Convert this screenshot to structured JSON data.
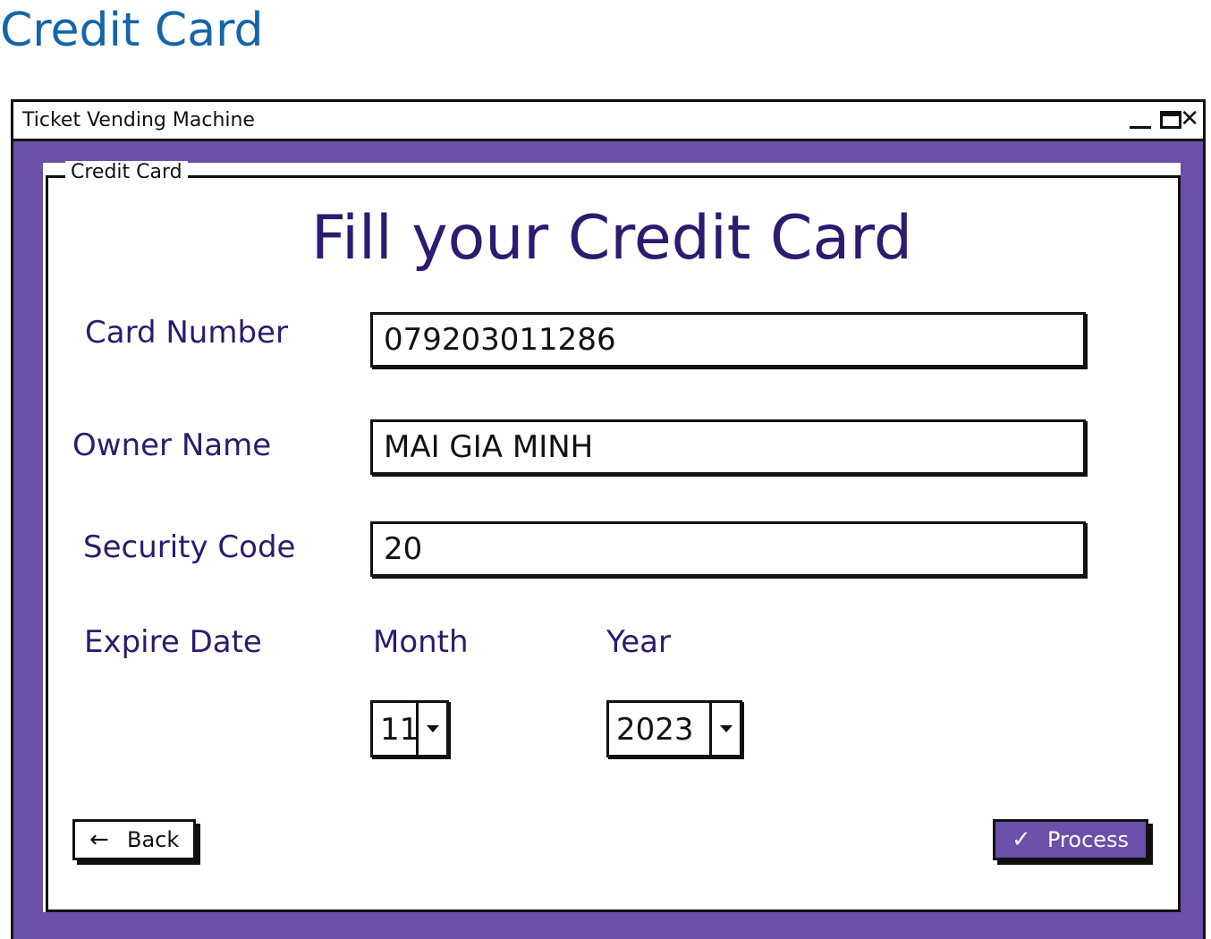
{
  "page": {
    "title": "Credit Card"
  },
  "window": {
    "title": "Ticket Vending Machine",
    "controls": {
      "minimize_icon": "minimize-icon",
      "maximize_icon": "maximize-icon",
      "close_icon": "close-icon",
      "close_glyph": "✕"
    }
  },
  "panel": {
    "legend": "Credit Card",
    "heading": "Fill your Credit Card",
    "card_number": {
      "label": "Card Number",
      "value": "079203011286"
    },
    "owner_name": {
      "label": "Owner Name",
      "value": "MAI GIA MINH"
    },
    "security_code": {
      "label": "Security Code",
      "value": "20"
    },
    "expire_date": {
      "label": "Expire Date",
      "month_label": "Month",
      "year_label": "Year",
      "month_value": "11",
      "year_value": "2023"
    },
    "buttons": {
      "back": {
        "label": "Back",
        "icon": "arrow-left-icon",
        "glyph": "←"
      },
      "process": {
        "label": "Process",
        "icon": "check-icon",
        "glyph": "✓"
      }
    }
  },
  "colors": {
    "page_title": "#1565a8",
    "window_frame": "#6b4fa8",
    "text_accent": "#2e1a6e"
  }
}
